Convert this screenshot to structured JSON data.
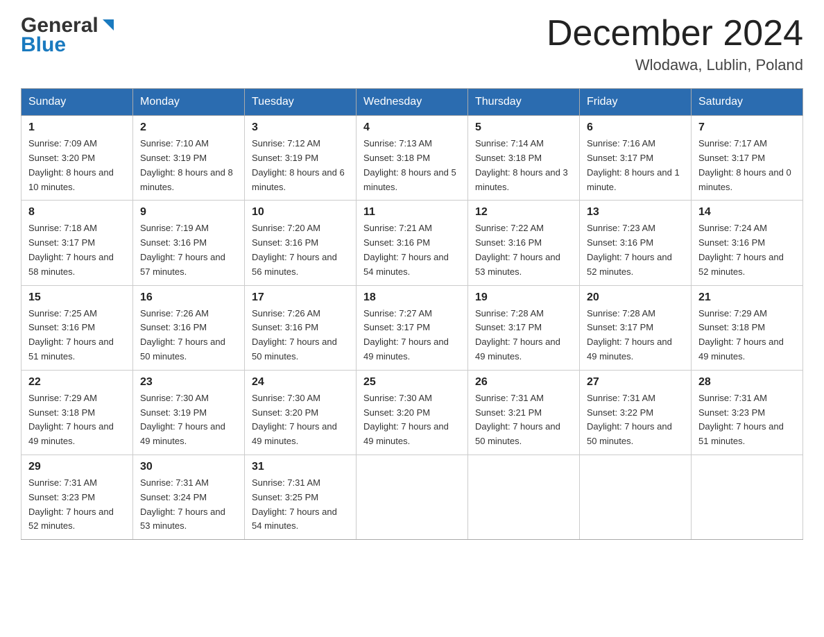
{
  "logo": {
    "general": "General",
    "blue": "Blue"
  },
  "header": {
    "month_year": "December 2024",
    "location": "Wlodawa, Lublin, Poland"
  },
  "weekdays": [
    "Sunday",
    "Monday",
    "Tuesday",
    "Wednesday",
    "Thursday",
    "Friday",
    "Saturday"
  ],
  "weeks": [
    [
      {
        "day": "1",
        "sunrise": "7:09 AM",
        "sunset": "3:20 PM",
        "daylight": "8 hours and 10 minutes."
      },
      {
        "day": "2",
        "sunrise": "7:10 AM",
        "sunset": "3:19 PM",
        "daylight": "8 hours and 8 minutes."
      },
      {
        "day": "3",
        "sunrise": "7:12 AM",
        "sunset": "3:19 PM",
        "daylight": "8 hours and 6 minutes."
      },
      {
        "day": "4",
        "sunrise": "7:13 AM",
        "sunset": "3:18 PM",
        "daylight": "8 hours and 5 minutes."
      },
      {
        "day": "5",
        "sunrise": "7:14 AM",
        "sunset": "3:18 PM",
        "daylight": "8 hours and 3 minutes."
      },
      {
        "day": "6",
        "sunrise": "7:16 AM",
        "sunset": "3:17 PM",
        "daylight": "8 hours and 1 minute."
      },
      {
        "day": "7",
        "sunrise": "7:17 AM",
        "sunset": "3:17 PM",
        "daylight": "8 hours and 0 minutes."
      }
    ],
    [
      {
        "day": "8",
        "sunrise": "7:18 AM",
        "sunset": "3:17 PM",
        "daylight": "7 hours and 58 minutes."
      },
      {
        "day": "9",
        "sunrise": "7:19 AM",
        "sunset": "3:16 PM",
        "daylight": "7 hours and 57 minutes."
      },
      {
        "day": "10",
        "sunrise": "7:20 AM",
        "sunset": "3:16 PM",
        "daylight": "7 hours and 56 minutes."
      },
      {
        "day": "11",
        "sunrise": "7:21 AM",
        "sunset": "3:16 PM",
        "daylight": "7 hours and 54 minutes."
      },
      {
        "day": "12",
        "sunrise": "7:22 AM",
        "sunset": "3:16 PM",
        "daylight": "7 hours and 53 minutes."
      },
      {
        "day": "13",
        "sunrise": "7:23 AM",
        "sunset": "3:16 PM",
        "daylight": "7 hours and 52 minutes."
      },
      {
        "day": "14",
        "sunrise": "7:24 AM",
        "sunset": "3:16 PM",
        "daylight": "7 hours and 52 minutes."
      }
    ],
    [
      {
        "day": "15",
        "sunrise": "7:25 AM",
        "sunset": "3:16 PM",
        "daylight": "7 hours and 51 minutes."
      },
      {
        "day": "16",
        "sunrise": "7:26 AM",
        "sunset": "3:16 PM",
        "daylight": "7 hours and 50 minutes."
      },
      {
        "day": "17",
        "sunrise": "7:26 AM",
        "sunset": "3:16 PM",
        "daylight": "7 hours and 50 minutes."
      },
      {
        "day": "18",
        "sunrise": "7:27 AM",
        "sunset": "3:17 PM",
        "daylight": "7 hours and 49 minutes."
      },
      {
        "day": "19",
        "sunrise": "7:28 AM",
        "sunset": "3:17 PM",
        "daylight": "7 hours and 49 minutes."
      },
      {
        "day": "20",
        "sunrise": "7:28 AM",
        "sunset": "3:17 PM",
        "daylight": "7 hours and 49 minutes."
      },
      {
        "day": "21",
        "sunrise": "7:29 AM",
        "sunset": "3:18 PM",
        "daylight": "7 hours and 49 minutes."
      }
    ],
    [
      {
        "day": "22",
        "sunrise": "7:29 AM",
        "sunset": "3:18 PM",
        "daylight": "7 hours and 49 minutes."
      },
      {
        "day": "23",
        "sunrise": "7:30 AM",
        "sunset": "3:19 PM",
        "daylight": "7 hours and 49 minutes."
      },
      {
        "day": "24",
        "sunrise": "7:30 AM",
        "sunset": "3:20 PM",
        "daylight": "7 hours and 49 minutes."
      },
      {
        "day": "25",
        "sunrise": "7:30 AM",
        "sunset": "3:20 PM",
        "daylight": "7 hours and 49 minutes."
      },
      {
        "day": "26",
        "sunrise": "7:31 AM",
        "sunset": "3:21 PM",
        "daylight": "7 hours and 50 minutes."
      },
      {
        "day": "27",
        "sunrise": "7:31 AM",
        "sunset": "3:22 PM",
        "daylight": "7 hours and 50 minutes."
      },
      {
        "day": "28",
        "sunrise": "7:31 AM",
        "sunset": "3:23 PM",
        "daylight": "7 hours and 51 minutes."
      }
    ],
    [
      {
        "day": "29",
        "sunrise": "7:31 AM",
        "sunset": "3:23 PM",
        "daylight": "7 hours and 52 minutes."
      },
      {
        "day": "30",
        "sunrise": "7:31 AM",
        "sunset": "3:24 PM",
        "daylight": "7 hours and 53 minutes."
      },
      {
        "day": "31",
        "sunrise": "7:31 AM",
        "sunset": "3:25 PM",
        "daylight": "7 hours and 54 minutes."
      },
      null,
      null,
      null,
      null
    ]
  ],
  "labels": {
    "sunrise": "Sunrise:",
    "sunset": "Sunset:",
    "daylight": "Daylight:"
  }
}
